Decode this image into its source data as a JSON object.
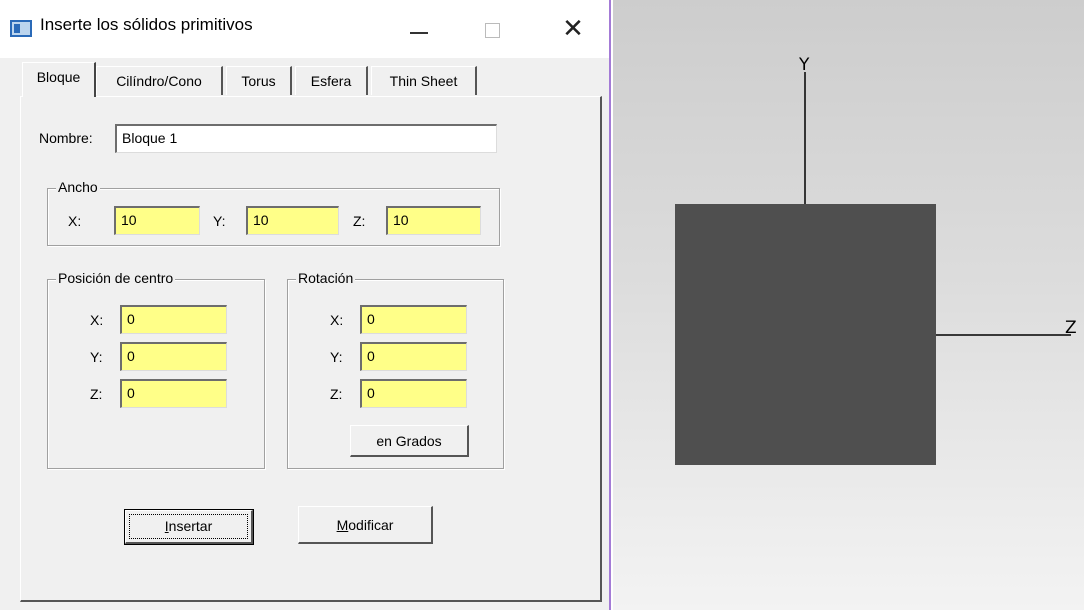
{
  "window": {
    "title": "Inserte los sólidos primitivos",
    "close_glyph": "✕"
  },
  "tabs": [
    "Bloque",
    "Cilíndro/Cono",
    "Torus",
    "Esfera",
    "Thin Sheet"
  ],
  "form": {
    "nombre_label": "Nombre:",
    "nombre_value": "Bloque 1",
    "ancho": {
      "title": "Ancho",
      "x_label": "X:",
      "x_value": "10",
      "y_label": "Y:",
      "y_value": "10",
      "z_label": "Z:",
      "z_value": "10"
    },
    "posicion": {
      "title": "Posición de centro",
      "x_label": "X:",
      "x_value": "0",
      "y_label": "Y:",
      "y_value": "0",
      "z_label": "Z:",
      "z_value": "0"
    },
    "rotacion": {
      "title": "Rotación",
      "x_label": "X:",
      "x_value": "0",
      "y_label": "Y:",
      "y_value": "0",
      "z_label": "Z:",
      "z_value": "0",
      "grados_button": "en Grados"
    },
    "insertar": {
      "first": "I",
      "rest": "nsertar"
    },
    "modificar": {
      "first": "M",
      "rest": "odificar"
    }
  },
  "viewport": {
    "axis_y_label": "Y",
    "axis_z_label": "Z",
    "block_color": "#4f4f4f",
    "axis_color": "#000000"
  },
  "colors": {
    "input_highlight": "#ffff88",
    "dialog_bg": "#f0f0f0",
    "window_border": "#a47bd6"
  }
}
